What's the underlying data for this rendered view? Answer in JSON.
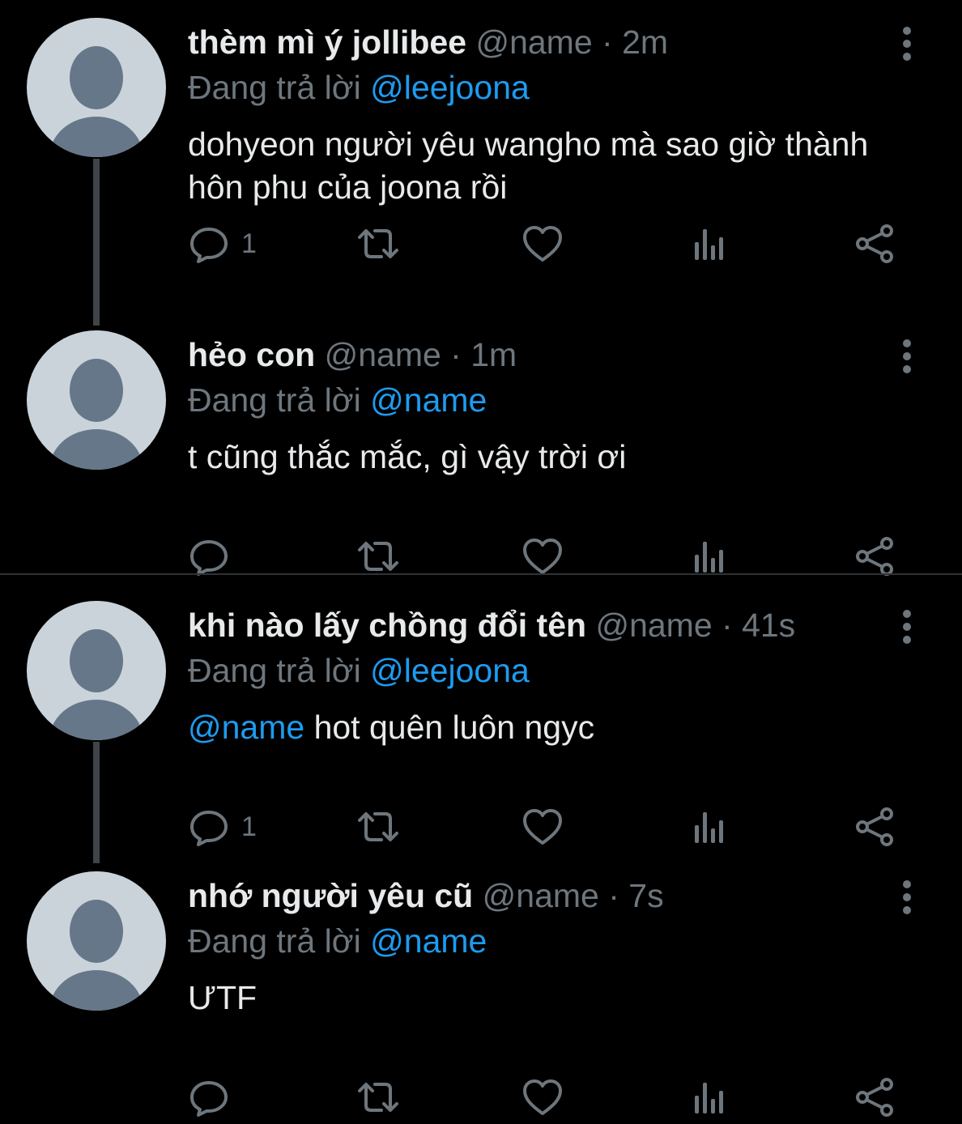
{
  "colors": {
    "background": "#000000",
    "text": "#e7e9ea",
    "muted": "#6e767d",
    "link": "#1d9bf0",
    "avatar": "#cbd3da",
    "avatar_figure": "#66778a"
  },
  "tweets": [
    {
      "name": "thèm mì ý jollibee",
      "handle": "@name",
      "time": "2m",
      "reply_label": "Đang trả lời",
      "reply_to": "@leejoona",
      "body_mention": "",
      "body_text": "dohyeon người yêu wangho mà sao giờ thành hôn phu của joona rồi",
      "reply_count": "1"
    },
    {
      "name": "hẻo con",
      "handle": "@name",
      "time": "1m",
      "reply_label": "Đang trả lời",
      "reply_to": "@name",
      "body_mention": "",
      "body_text": "t cũng thắc mắc, gì vậy trời ơi",
      "reply_count": ""
    },
    {
      "name": "khi nào lấy chồng đổi tên",
      "handle": "@name",
      "time": "41s",
      "reply_label": "Đang trả lời",
      "reply_to": "@leejoona",
      "body_mention": "@name",
      "body_text": " hot quên luôn ngyc",
      "reply_count": "1"
    },
    {
      "name": "nhớ người yêu cũ",
      "handle": "@name",
      "time": "7s",
      "reply_label": "Đang trả lời",
      "reply_to": "@name",
      "body_mention": "",
      "body_text": "ƯTF",
      "reply_count": ""
    }
  ],
  "icons": [
    "reply-icon",
    "retweet-icon",
    "like-icon",
    "analytics-icon",
    "share-icon",
    "more-options-icon"
  ]
}
